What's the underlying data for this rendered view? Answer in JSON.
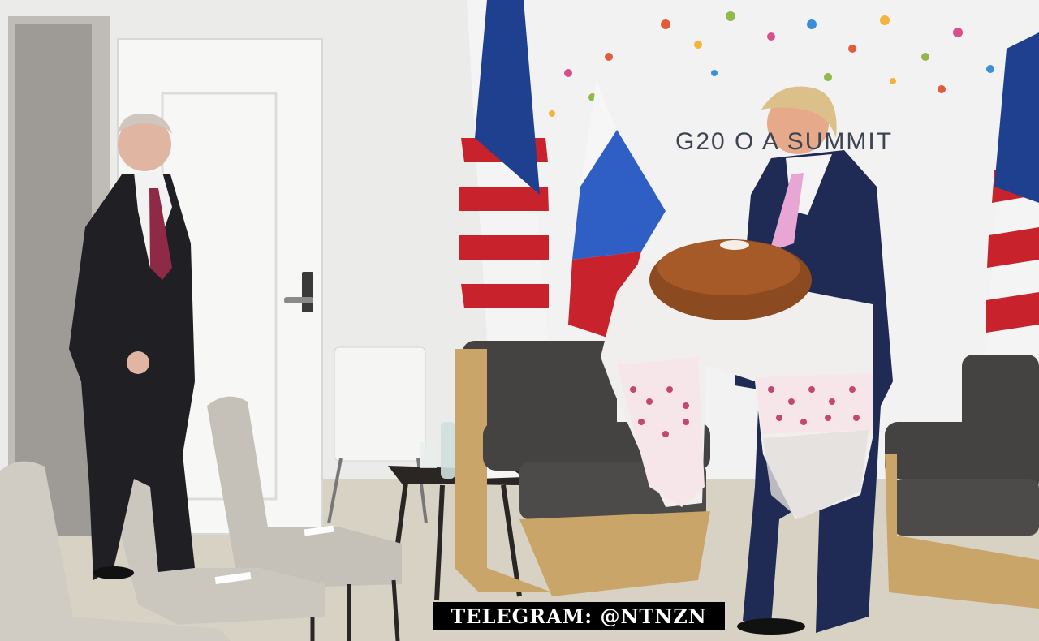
{
  "backdrop": {
    "text": "G20 O     A SUMMIT"
  },
  "watermark": {
    "text": "TELEGRAM: @NTNZN"
  },
  "colors": {
    "wall": "#ebebea",
    "floor": "#d8d2c4",
    "suit_dark": "#1f1f24",
    "suit_navy": "#1f2b55",
    "chair_wood": "#c9a56a",
    "chair_cushion": "#454342",
    "flag_red": "#c8222c",
    "flag_blue": "#1f3f8f",
    "russia_blue": "#2f5fc4",
    "bread": "#8b4a20",
    "towel": "#f0efed",
    "embroidery": "#c4486a"
  }
}
